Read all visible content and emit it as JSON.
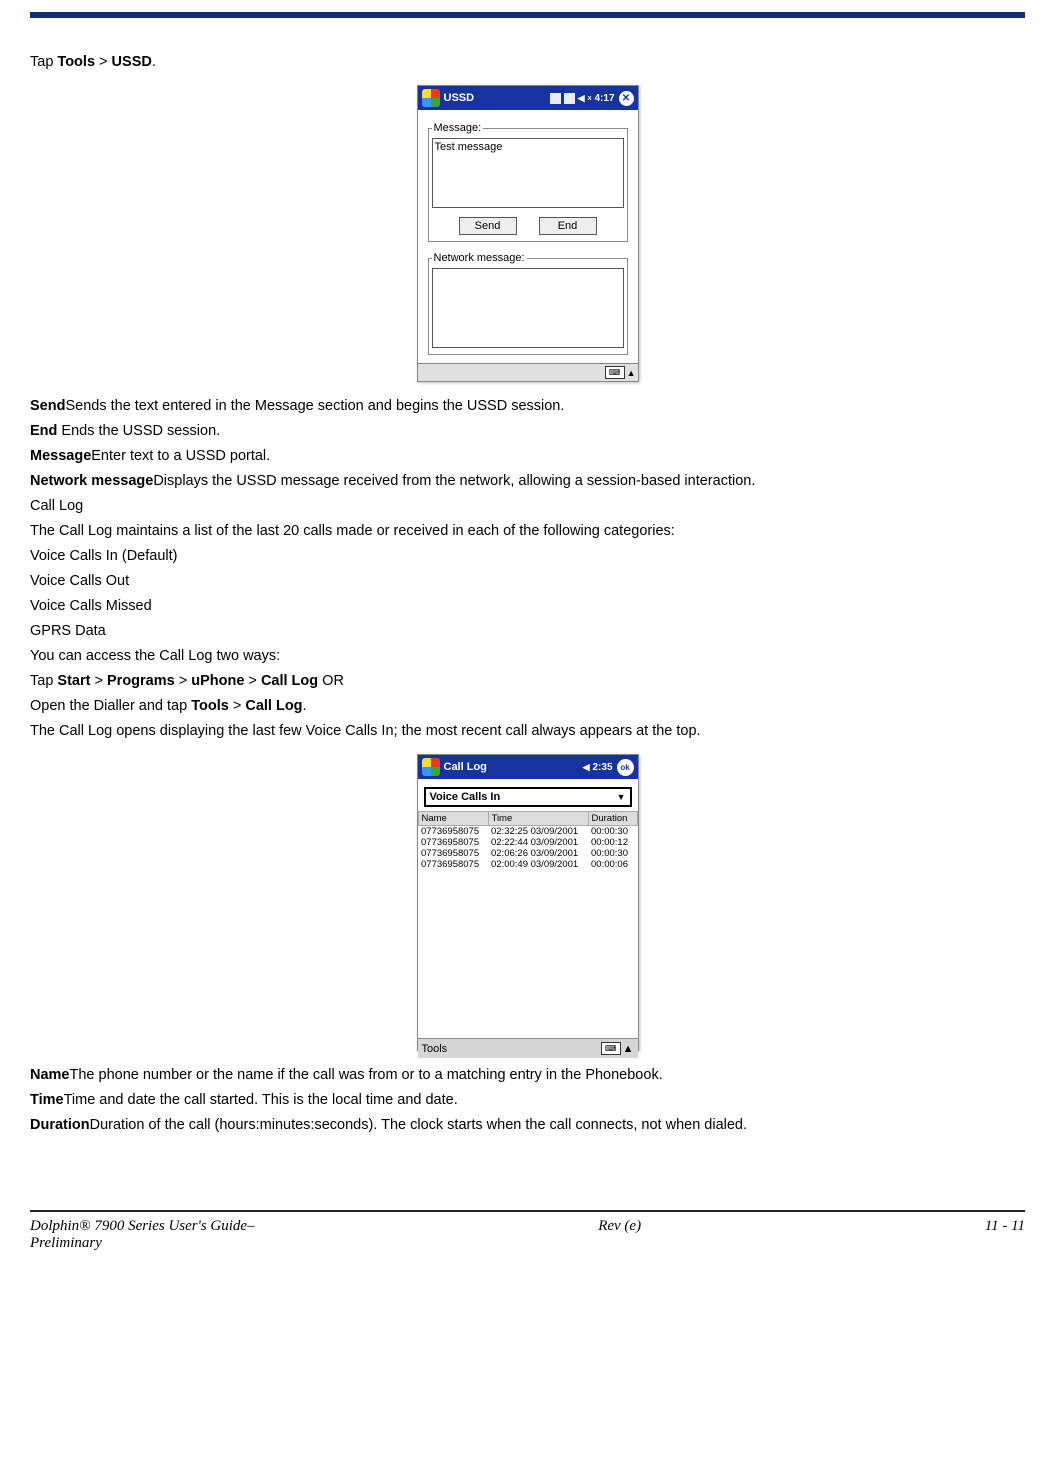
{
  "intro": {
    "pre": "Tap ",
    "b1": "Tools",
    "mid": " > ",
    "b2": "USSD",
    "post": "."
  },
  "ussd_device": {
    "title": "USSD",
    "time": "4:17",
    "msg_legend": "Message:",
    "msg_value": "Test message",
    "send": "Send",
    "end": "End",
    "net_legend": "Network message:"
  },
  "defs": {
    "send": {
      "term": "Send",
      "desc": "Sends the text entered in the Message section and begins the USSD session."
    },
    "end": {
      "term": "End",
      "desc": "  Ends the USSD session."
    },
    "message": {
      "term": "Message",
      "desc": "Enter text to a USSD portal."
    },
    "network": {
      "term": "Network message",
      "desc": "Displays the USSD message received from the network, allowing a session-based interaction."
    }
  },
  "calllog": {
    "heading": "Call Log",
    "intro": "The Call Log maintains a list of the last 20 calls made or received in each of the following categories:",
    "cats": [
      "Voice Calls In (Default)",
      "Voice Calls Out",
      "Voice Calls Missed",
      "GPRS Data"
    ],
    "access": "You can access the Call Log two ways:",
    "path1": {
      "pre": "Tap ",
      "b1": "Start",
      "s1": " > ",
      "b2": "Programs",
      "s2": " > ",
      "b3": "uPhone",
      "s3": " > ",
      "b4": "Call Log",
      "post": " OR"
    },
    "path2": {
      "pre": "Open the Dialler  and tap ",
      "b1": "Tools",
      "s1": " > ",
      "b2": "Call Log",
      "post": "."
    },
    "opens": "The Call Log opens displaying the last few Voice Calls In; the most recent call always appears at the top."
  },
  "log_device": {
    "title": "Call Log",
    "time": "2:35",
    "ok": "ok",
    "combo": "Voice Calls In",
    "headers": {
      "name": "Name",
      "time": "Time",
      "dur": "Duration"
    },
    "rows": [
      {
        "name": "07736958075",
        "time": "02:32:25 03/09/2001",
        "dur": "00:00:30"
      },
      {
        "name": "07736958075",
        "time": "02:22:44 03/09/2001",
        "dur": "00:00:12"
      },
      {
        "name": "07736958075",
        "time": "02:06:26 03/09/2001",
        "dur": "00:00:30"
      },
      {
        "name": "07736958075",
        "time": "02:00:49 03/09/2001",
        "dur": "00:00:06"
      }
    ],
    "tools": "Tools"
  },
  "defs2": {
    "name": {
      "term": "Name",
      "desc": "The phone number or the name if the call was from or to a matching entry in the Phonebook."
    },
    "time": {
      "term": "Time",
      "desc": "Time and date the call started. This is the local time and date."
    },
    "dur": {
      "term": "Duration",
      "desc": "Duration of the call (hours:minutes:seconds). The clock starts when the call connects, not when dialed."
    }
  },
  "footer": {
    "left1": "Dolphin® 7900 Series User's Guide–",
    "left2": "Preliminary",
    "center": "Rev (e)",
    "right": "11 - 11"
  }
}
